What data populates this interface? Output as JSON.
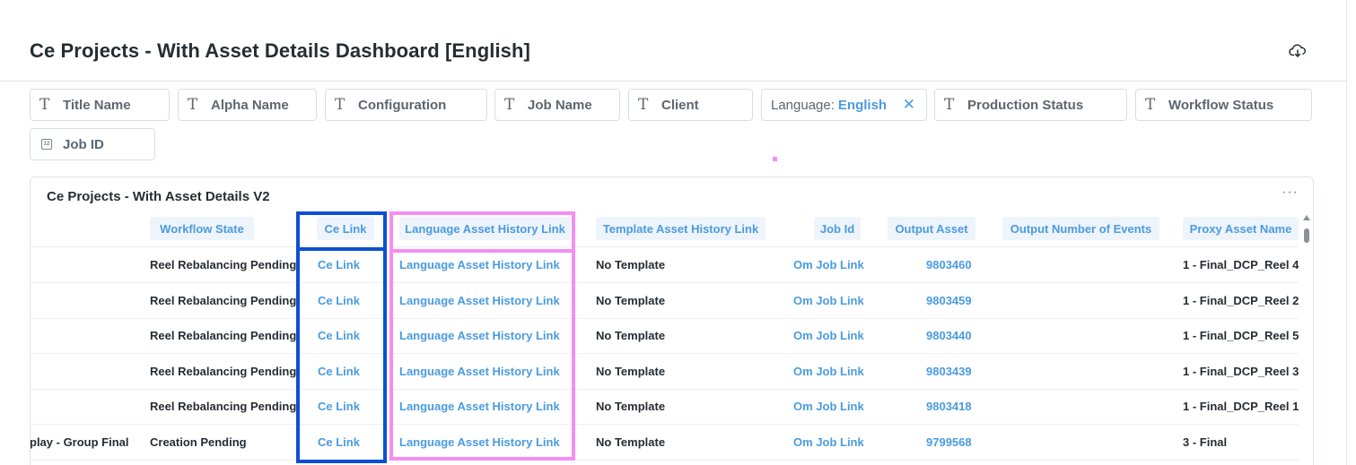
{
  "page": {
    "title": "Ce Projects - With Asset Details Dashboard [English]"
  },
  "filters": [
    {
      "label": "Title Name",
      "icon": "text-type-icon"
    },
    {
      "label": "Alpha Name",
      "icon": "text-type-icon"
    },
    {
      "label": "Configuration",
      "icon": "text-type-icon"
    },
    {
      "label": "Job Name",
      "icon": "text-type-icon"
    },
    {
      "label": "Client",
      "icon": "text-type-icon"
    },
    {
      "label": "Language:",
      "value": "English",
      "clear": "✕"
    },
    {
      "label": "Production Status",
      "icon": "text-type-icon"
    },
    {
      "label": "Workflow Status",
      "icon": "text-type-icon"
    },
    {
      "label": "Job ID",
      "icon": "number-type-icon"
    }
  ],
  "card": {
    "title": "Ce Projects - With Asset Details V2",
    "menu": "···",
    "columns": [
      "Workflow State",
      "Ce Link",
      "Language Asset History Link",
      "Template Asset History Link",
      "Job Id",
      "Output Asset",
      "Output Number of Events",
      "Proxy Asset Name"
    ],
    "rows": [
      {
        "prev": "",
        "workflow_state": "Reel Rebalancing Pending",
        "ce_link": "Ce Link",
        "lang_link": "Language Asset History Link",
        "template": "No Template",
        "job_id": "Om Job Link",
        "output_asset": "9803460",
        "events": "",
        "proxy": "1 - Final_DCP_Reel 4"
      },
      {
        "prev": "",
        "workflow_state": "Reel Rebalancing Pending",
        "ce_link": "Ce Link",
        "lang_link": "Language Asset History Link",
        "template": "No Template",
        "job_id": "Om Job Link",
        "output_asset": "9803459",
        "events": "",
        "proxy": "1 - Final_DCP_Reel 2"
      },
      {
        "prev": "",
        "workflow_state": "Reel Rebalancing Pending",
        "ce_link": "Ce Link",
        "lang_link": "Language Asset History Link",
        "template": "No Template",
        "job_id": "Om Job Link",
        "output_asset": "9803440",
        "events": "",
        "proxy": "1 - Final_DCP_Reel 5"
      },
      {
        "prev": "",
        "workflow_state": "Reel Rebalancing Pending",
        "ce_link": "Ce Link",
        "lang_link": "Language Asset History Link",
        "template": "No Template",
        "job_id": "Om Job Link",
        "output_asset": "9803439",
        "events": "",
        "proxy": "1 - Final_DCP_Reel 3"
      },
      {
        "prev": "",
        "workflow_state": "Reel Rebalancing Pending",
        "ce_link": "Ce Link",
        "lang_link": "Language Asset History Link",
        "template": "No Template",
        "job_id": "Om Job Link",
        "output_asset": "9803418",
        "events": "",
        "proxy": "1 - Final_DCP_Reel 1"
      },
      {
        "prev": "play - Group Final",
        "workflow_state": "Creation Pending",
        "ce_link": "Ce Link",
        "lang_link": "Language Asset History Link",
        "template": "No Template",
        "job_id": "Om Job Link",
        "output_asset": "9799568",
        "events": "",
        "proxy": "3 - Final"
      }
    ]
  },
  "colors": {
    "accent": "#4a9be0",
    "highlight_blue": "#0b4fd4",
    "highlight_pink": "#f58df2"
  }
}
